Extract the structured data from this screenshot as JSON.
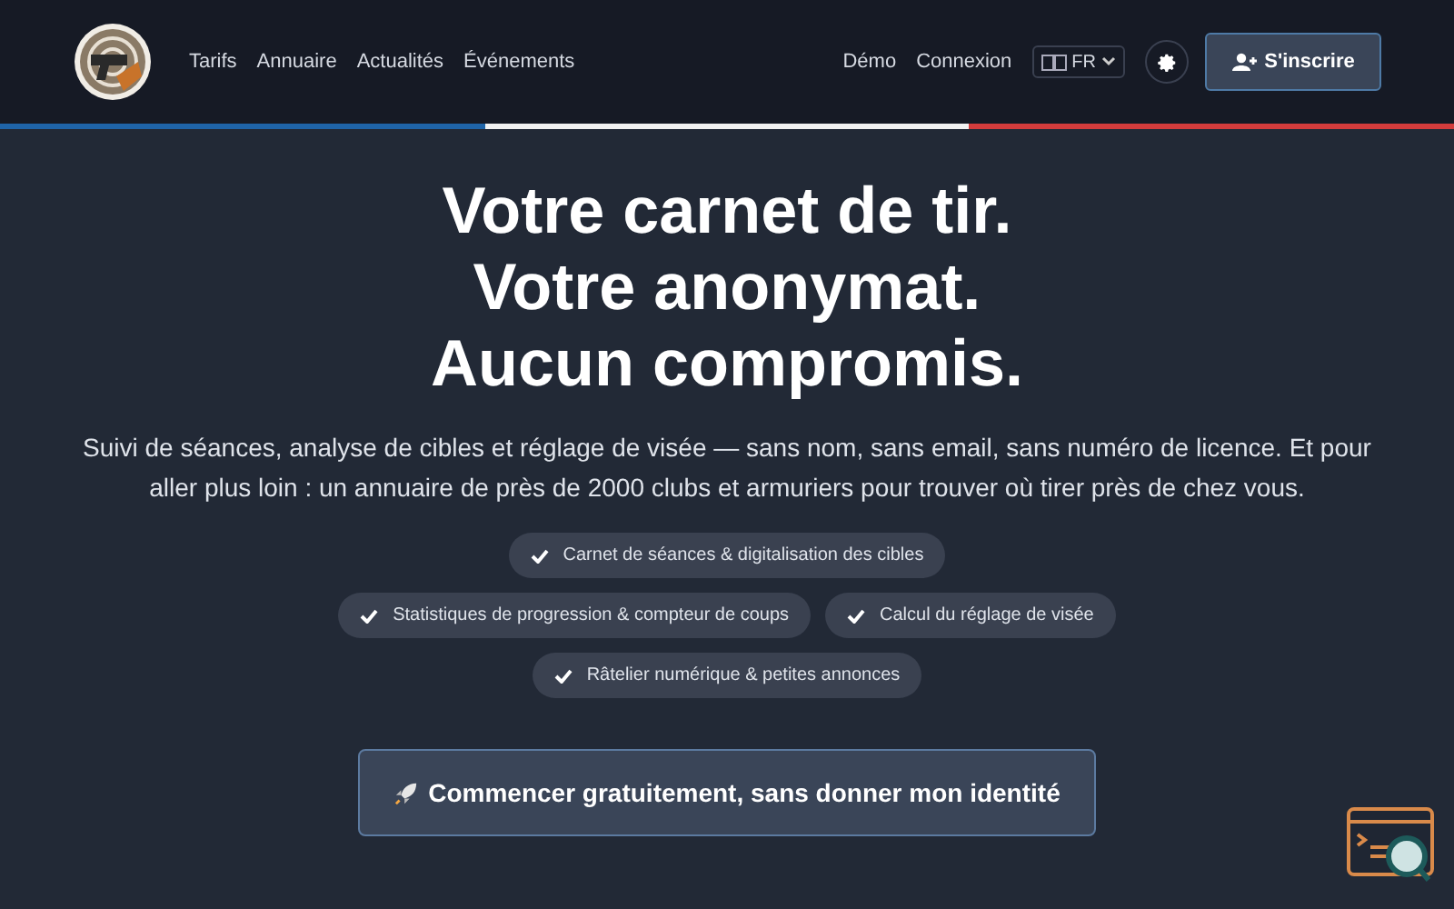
{
  "nav": {
    "links": [
      "Tarifs",
      "Annuaire",
      "Actualités",
      "Événements"
    ],
    "right_links": [
      "Démo",
      "Connexion"
    ],
    "language": "FR",
    "signup": "S'inscrire"
  },
  "hero": {
    "title_lines": [
      "Votre carnet de tir.",
      "Votre anonymat.",
      "Aucun compromis."
    ],
    "subtitle": "Suivi de séances, analyse de cibles et réglage de visée — sans nom, sans email, sans numéro de licence. Et pour aller plus loin : un annuaire de près de 2000 clubs et armuriers pour trouver où tirer près de chez vous.",
    "features": [
      [
        "Carnet de séances & digitalisation des cibles"
      ],
      [
        "Statistiques de progression & compteur de coups",
        "Calcul du réglage de visée"
      ],
      [
        "Râtelier numérique & petites annonces"
      ]
    ],
    "cta": "Commencer gratuitement, sans donner mon identité"
  }
}
